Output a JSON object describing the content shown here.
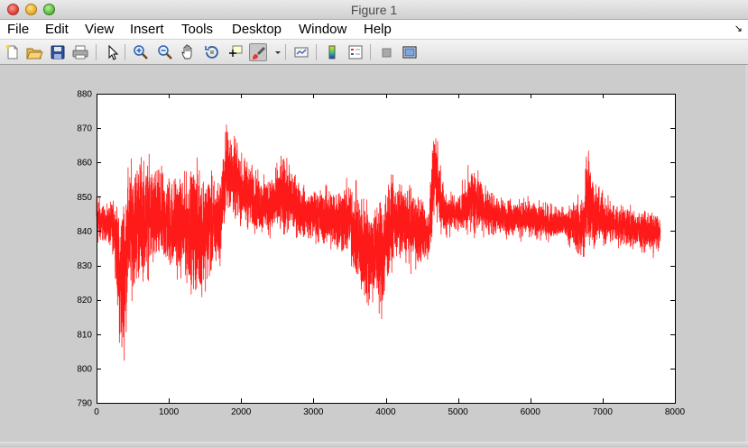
{
  "window": {
    "title": "Figure 1"
  },
  "menu": [
    "File",
    "Edit",
    "View",
    "Insert",
    "Tools",
    "Desktop",
    "Window",
    "Help"
  ],
  "toolbar": {
    "buttons": [
      "new-figure-icon",
      "open-file-icon",
      "save-icon",
      "print-icon",
      "edit-plot-arrow-icon",
      "zoom-in-icon",
      "zoom-out-icon",
      "pan-hand-icon",
      "rotate-3d-icon",
      "data-cursor-icon",
      "brush-icon",
      "brush-dropdown-icon",
      "link-plot-icon",
      "insert-colorbar-icon",
      "insert-legend-icon",
      "hide-plot-tools-icon",
      "show-plot-tools-icon"
    ]
  },
  "colors": {
    "series": "#ff1a1a",
    "axes_bg": "#ffffff",
    "figure_bg": "#cccccc"
  },
  "chart_data": {
    "type": "line",
    "xlim": [
      0,
      8000
    ],
    "ylim": [
      790,
      880
    ],
    "xticks": [
      0,
      1000,
      2000,
      3000,
      4000,
      5000,
      6000,
      7000,
      8000
    ],
    "yticks": [
      790,
      800,
      810,
      820,
      830,
      840,
      850,
      860,
      870,
      880
    ],
    "grid": false,
    "series_color": "#ff1a1a",
    "n_points": 7800,
    "envelope": [
      {
        "x": 0,
        "lo": 832,
        "hi": 855
      },
      {
        "x": 120,
        "lo": 836,
        "hi": 848
      },
      {
        "x": 250,
        "lo": 830,
        "hi": 852
      },
      {
        "x": 320,
        "lo": 800,
        "hi": 850
      },
      {
        "x": 360,
        "lo": 792,
        "hi": 860
      },
      {
        "x": 450,
        "lo": 815,
        "hi": 865
      },
      {
        "x": 600,
        "lo": 820,
        "hi": 868
      },
      {
        "x": 900,
        "lo": 825,
        "hi": 862
      },
      {
        "x": 1200,
        "lo": 822,
        "hi": 860
      },
      {
        "x": 1400,
        "lo": 815,
        "hi": 866
      },
      {
        "x": 1700,
        "lo": 826,
        "hi": 858
      },
      {
        "x": 1800,
        "lo": 842,
        "hi": 876
      },
      {
        "x": 2000,
        "lo": 838,
        "hi": 866
      },
      {
        "x": 2300,
        "lo": 836,
        "hi": 858
      },
      {
        "x": 2600,
        "lo": 835,
        "hi": 865
      },
      {
        "x": 2900,
        "lo": 836,
        "hi": 854
      },
      {
        "x": 3200,
        "lo": 832,
        "hi": 856
      },
      {
        "x": 3500,
        "lo": 828,
        "hi": 858
      },
      {
        "x": 3700,
        "lo": 812,
        "hi": 856
      },
      {
        "x": 3850,
        "lo": 815,
        "hi": 852
      },
      {
        "x": 3950,
        "lo": 808,
        "hi": 860
      },
      {
        "x": 4100,
        "lo": 828,
        "hi": 858
      },
      {
        "x": 4400,
        "lo": 826,
        "hi": 856
      },
      {
        "x": 4600,
        "lo": 828,
        "hi": 850
      },
      {
        "x": 4680,
        "lo": 840,
        "hi": 877
      },
      {
        "x": 4800,
        "lo": 836,
        "hi": 856
      },
      {
        "x": 5000,
        "lo": 838,
        "hi": 852
      },
      {
        "x": 5200,
        "lo": 836,
        "hi": 863
      },
      {
        "x": 5500,
        "lo": 837,
        "hi": 852
      },
      {
        "x": 6000,
        "lo": 836,
        "hi": 851
      },
      {
        "x": 6500,
        "lo": 836,
        "hi": 848
      },
      {
        "x": 6750,
        "lo": 826,
        "hi": 856
      },
      {
        "x": 6780,
        "lo": 830,
        "hi": 875
      },
      {
        "x": 6900,
        "lo": 833,
        "hi": 856
      },
      {
        "x": 7200,
        "lo": 834,
        "hi": 850
      },
      {
        "x": 7500,
        "lo": 833,
        "hi": 848
      },
      {
        "x": 7800,
        "lo": 831,
        "hi": 847
      }
    ]
  }
}
